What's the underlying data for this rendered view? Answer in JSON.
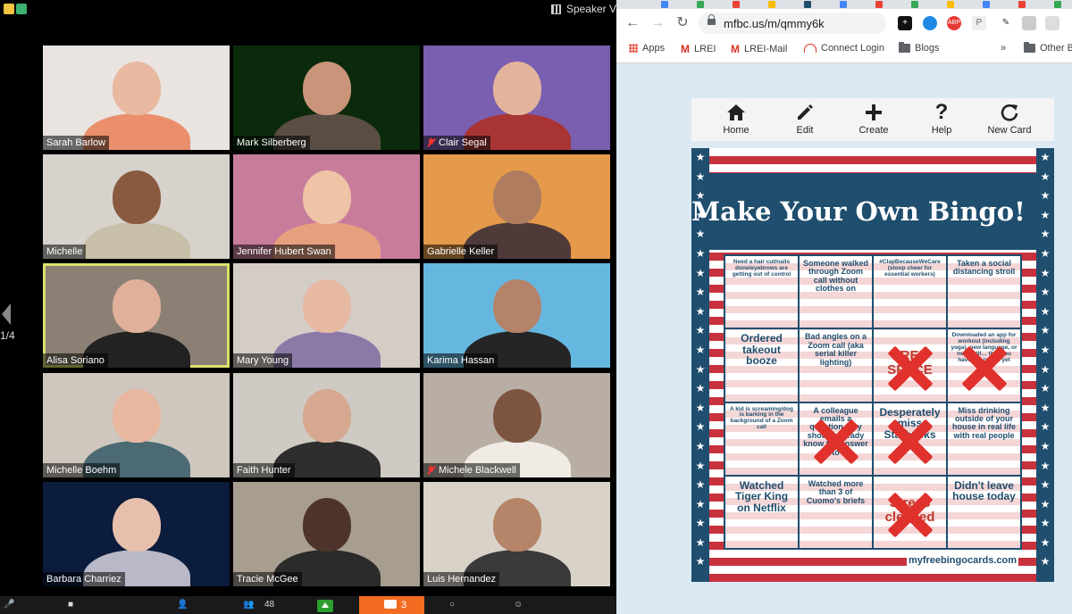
{
  "zoom": {
    "view_label": "Speaker V",
    "page_indicator": "1/4",
    "participants": [
      {
        "name": "Sarah Barlow",
        "muted": false,
        "bg": "#e9e4df",
        "skin": "#e8b8a0",
        "shirt": "#ea8e6c"
      },
      {
        "name": "Mark Silberberg",
        "muted": false,
        "bg": "#0b2a0b",
        "skin": "#c9947a",
        "shirt": "#5a4e44"
      },
      {
        "name": "Clair Segal",
        "muted": true,
        "bg": "#7a5fb0",
        "skin": "#e3b49b",
        "shirt": "#a93434"
      },
      {
        "name": "Michelle",
        "muted": false,
        "bg": "#d7d2cc",
        "skin": "#8a5a40",
        "shirt": "#c8bfa8"
      },
      {
        "name": "Jennifer Hubert Swan",
        "muted": false,
        "bg": "#c87c9c",
        "skin": "#efc3a6",
        "shirt": "#e7a07e"
      },
      {
        "name": "Gabrielle Keller",
        "muted": false,
        "bg": "#e49a4a",
        "skin": "#b07c60",
        "shirt": "#4f3a3a"
      },
      {
        "name": "Alisa Soriano",
        "muted": false,
        "bg": "#8c7f74",
        "skin": "#e0b09a",
        "shirt": "#222222"
      },
      {
        "name": "Mary Young",
        "muted": false,
        "bg": "#d4cdc6",
        "skin": "#e7b8a2",
        "shirt": "#8b7aa8"
      },
      {
        "name": "Karima Hassan",
        "muted": false,
        "bg": "#66b7e0",
        "skin": "#b4836a",
        "shirt": "#252525"
      },
      {
        "name": "Michelle Boehm",
        "muted": false,
        "bg": "#cfc7bd",
        "skin": "#e9b6a0",
        "shirt": "#4b6a73"
      },
      {
        "name": "Faith Hunter",
        "muted": false,
        "bg": "#cfcac3",
        "skin": "#d7a890",
        "shirt": "#2e2e2e"
      },
      {
        "name": "Michele Blackwell",
        "muted": true,
        "bg": "#b8aea3",
        "skin": "#7c5440",
        "shirt": "#f0ebe5"
      },
      {
        "name": "Barbara Charriez",
        "muted": false,
        "bg": "#0b1c3c",
        "skin": "#e7c0ad",
        "shirt": "#b8b8c8"
      },
      {
        "name": "Tracie McGee",
        "muted": false,
        "bg": "#a89e90",
        "skin": "#4e342a",
        "shirt": "#2b2b2b"
      },
      {
        "name": "Luis Hernandez",
        "muted": false,
        "bg": "#d9d2c8",
        "skin": "#b68468",
        "shirt": "#3a3a3a"
      },
      {
        "name": "",
        "muted": false,
        "bg": "#5a5a5a",
        "skin": "#6b4634",
        "shirt": "#111111"
      }
    ],
    "toolbar": {
      "participants_count": "48",
      "chat_count": "3"
    }
  },
  "browser": {
    "url": "mfbc.us/m/qmmy6k",
    "bookmarks": [
      "Apps",
      "LREI",
      "LREI-Mail",
      "Connect Login",
      "Blogs"
    ],
    "overflow": "»",
    "other_bookmarks": "Other B",
    "extensions": [
      "+",
      "ABP",
      "P"
    ]
  },
  "bingo": {
    "toolbar": [
      {
        "label": "Home",
        "icon": "home-icon"
      },
      {
        "label": "Edit",
        "icon": "pencil-icon"
      },
      {
        "label": "Create",
        "icon": "plus-icon"
      },
      {
        "label": "Help",
        "icon": "question-icon"
      },
      {
        "label": "New Card",
        "icon": "refresh-icon"
      }
    ],
    "title": "Make Your Own Bingo!",
    "footer": "myfreebingocards.com",
    "cells": [
      {
        "text": "Need a hair cut/nails done/eyebrows are getting out of control",
        "size": "small",
        "marked": false
      },
      {
        "text": "Someone walked through Zoom call without clothes on",
        "size": "medium",
        "marked": false
      },
      {
        "text": "#ClapBecauseWeCare (stoop cheer for essential workers)",
        "size": "small",
        "marked": false
      },
      {
        "text": "Taken a social distancing stroll",
        "size": "medium",
        "marked": false
      },
      {
        "text": "Ordered takeout booze",
        "size": "large",
        "marked": false
      },
      {
        "text": "Bad angles on a Zoom call (aka serial killer lighting)",
        "size": "medium",
        "marked": false
      },
      {
        "text": "FREE SPACE",
        "size": "xlarge",
        "marked": true
      },
      {
        "text": "Downloaded an app for workout (including yoga), new language, or new skill… that you haven't opened yet",
        "size": "small",
        "marked": true
      },
      {
        "text": "A kid is screaming/dog is barking in the background of a Zoom call",
        "size": "small",
        "marked": false
      },
      {
        "text": "A colleague emails a question they should already know the answer to",
        "size": "medium",
        "marked": true
      },
      {
        "text": "Desperately miss Starbucks",
        "size": "large",
        "marked": true
      },
      {
        "text": "Miss drinking outside of your house in real life with real people",
        "size": "medium",
        "marked": false
      },
      {
        "text": "Watched Tiger King on Netflix",
        "size": "large",
        "marked": false
      },
      {
        "text": "Watched more than 3 of Cuomo's briefs",
        "size": "medium",
        "marked": false
      },
      {
        "text": "Stress cleaned",
        "size": "xlarge",
        "marked": true
      },
      {
        "text": "Didn't leave house today",
        "size": "large",
        "marked": false
      }
    ]
  }
}
